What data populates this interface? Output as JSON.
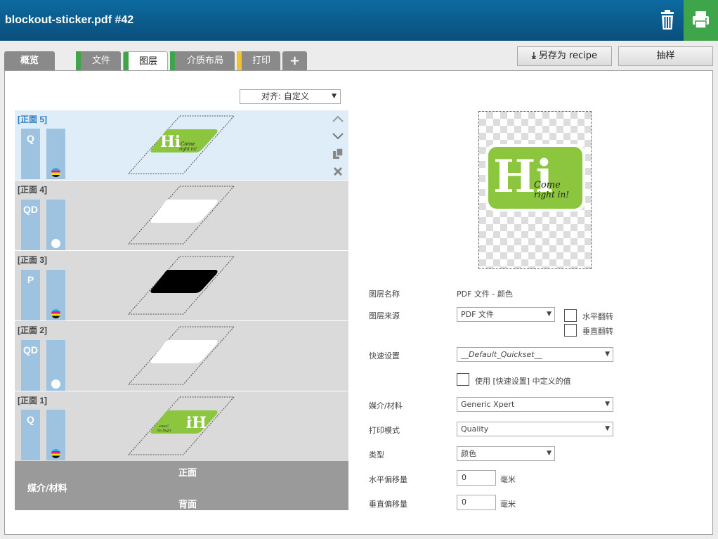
{
  "header": {
    "title": "blockout-sticker.pdf #42"
  },
  "tabs": [
    {
      "label": "概览",
      "accent": ""
    },
    {
      "label": "文件",
      "accent": "#3ea54a"
    },
    {
      "label": "图层",
      "accent": "#3ea54a"
    },
    {
      "label": "介质布局",
      "accent": "#3ea54a"
    },
    {
      "label": "打印",
      "accent": "#f0c330"
    },
    {
      "label": "+",
      "accent": ""
    }
  ],
  "actions": {
    "save_recipe": "另存为 recipe",
    "sample": "抽样"
  },
  "align": {
    "value": "对齐: 自定义"
  },
  "layers": [
    {
      "label": "[正面 5]",
      "mode": "Q",
      "ink": "cmyk",
      "shape": "green-hi",
      "selected": true
    },
    {
      "label": "[正面 4]",
      "mode": "QD",
      "ink": "white",
      "shape": "white"
    },
    {
      "label": "[正面 3]",
      "mode": "P",
      "ink": "cmyk",
      "shape": "black"
    },
    {
      "label": "[正面 2]",
      "mode": "QD",
      "ink": "white",
      "shape": "white"
    },
    {
      "label": "[正面 1]",
      "mode": "Q",
      "ink": "cmyk",
      "shape": "green-ih"
    }
  ],
  "bottom": {
    "front": "正面",
    "media": "媒介/材料",
    "back": "背面"
  },
  "preview": {
    "big": "Hi",
    "script_line1": "Come",
    "script_line2": "right in!",
    "green": "#8cc63f"
  },
  "properties": {
    "layer_name_label": "图层名称",
    "layer_name_value": "PDF 文件 - 颜色",
    "layer_source_label": "图层来源",
    "layer_source_value": "PDF 文件",
    "flip_h": "水平翻转",
    "flip_v": "垂直翻转",
    "quickset_label": "快速设置",
    "quickset_value": "__Default_Quickset__",
    "use_quickset": "使用 [快速设置] 中定义的值",
    "media_label": "媒介/材料",
    "media_value": "Generic Xpert",
    "printmode_label": "打印模式",
    "printmode_value": "Quality",
    "type_label": "类型",
    "type_value": "颜色",
    "hoffset_label": "水平偏移量",
    "hoffset_value": "0",
    "voffset_label": "垂直偏移量",
    "voffset_value": "0",
    "unit": "毫米"
  }
}
